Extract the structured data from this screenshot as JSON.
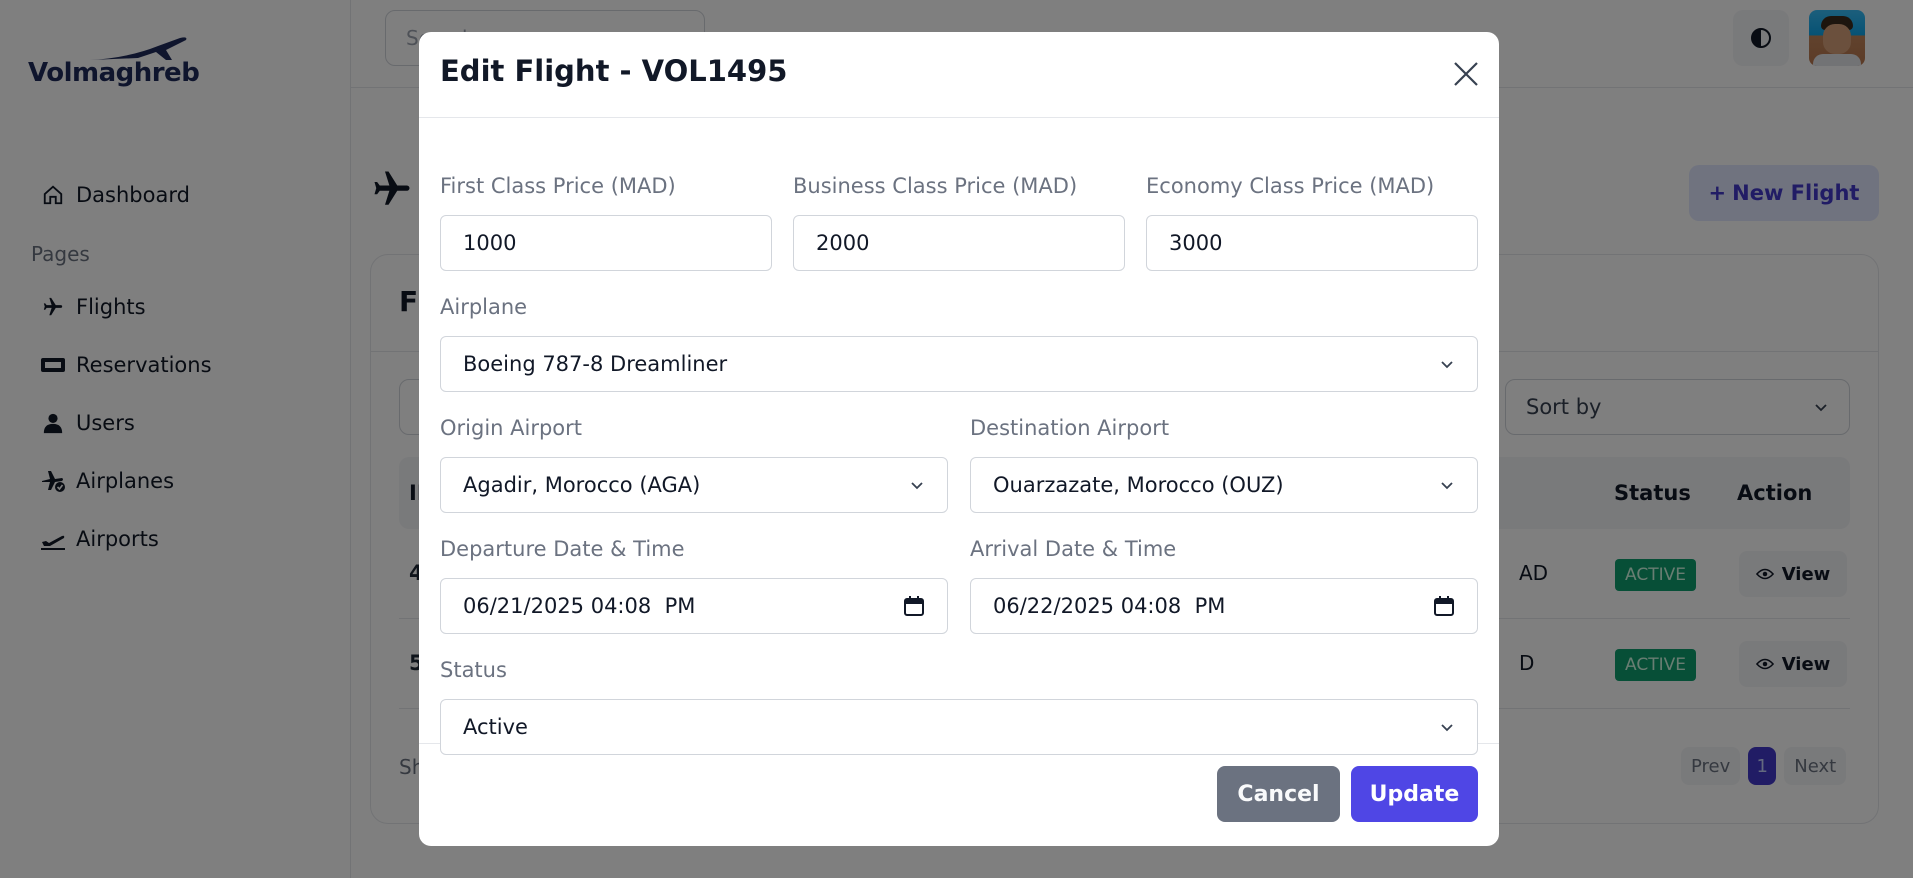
{
  "app": {
    "logo_text": "Volmaghreb"
  },
  "sidebar": {
    "section_label": "Pages",
    "items": [
      {
        "label": "Dashboard",
        "icon": "home-icon"
      },
      {
        "label": "Flights",
        "icon": "plane-icon"
      },
      {
        "label": "Reservations",
        "icon": "ticket-icon"
      },
      {
        "label": "Users",
        "icon": "user-icon"
      },
      {
        "label": "Airplanes",
        "icon": "airplane-check-icon"
      },
      {
        "label": "Airports",
        "icon": "plane-departure-icon"
      }
    ]
  },
  "topbar": {
    "search_placeholder": "Search"
  },
  "page": {
    "new_flight_label": "New Flight",
    "card_title": "Fl",
    "sort_label": "Sort by",
    "columns": {
      "id": "ID",
      "status": "Status",
      "action": "Action"
    },
    "rows": [
      {
        "id": "4",
        "price": "AD",
        "status": "ACTIVE",
        "action": "View"
      },
      {
        "id": "5",
        "price": "D",
        "status": "ACTIVE",
        "action": "View"
      }
    ],
    "showing": "Sh",
    "pagination": {
      "prev": "Prev",
      "current": "1",
      "next": "Next"
    }
  },
  "modal": {
    "title": "Edit Flight - VOL1495",
    "first_class": {
      "label": "First Class Price (MAD)",
      "value": "1000"
    },
    "business_class": {
      "label": "Business Class Price (MAD)",
      "value": "2000"
    },
    "economy_class": {
      "label": "Economy Class Price (MAD)",
      "value": "3000"
    },
    "airplane": {
      "label": "Airplane",
      "value": "Boeing 787-8 Dreamliner"
    },
    "origin": {
      "label": "Origin Airport",
      "value": "Agadir, Morocco (AGA)"
    },
    "destination": {
      "label": "Destination Airport",
      "value": "Ouarzazate, Morocco (OUZ)"
    },
    "departure": {
      "label": "Departure Date & Time",
      "value": "06/21/2025 04:08  PM"
    },
    "arrival": {
      "label": "Arrival Date & Time",
      "value": "06/22/2025 04:08  PM"
    },
    "status": {
      "label": "Status",
      "value": "Active"
    },
    "cancel_label": "Cancel",
    "update_label": "Update"
  },
  "colors": {
    "accent": "#4f46e5",
    "badge_active": "#0e9f6e",
    "cancel": "#6b7280"
  }
}
